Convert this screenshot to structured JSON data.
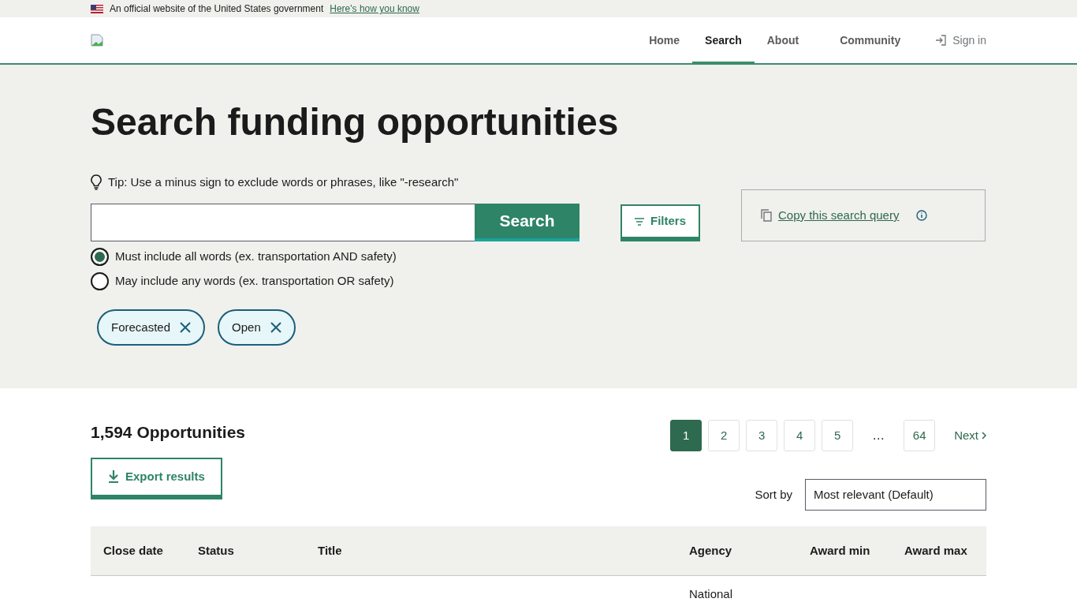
{
  "banner": {
    "text": "An official website of the United States government",
    "link": "Here's how you know"
  },
  "nav": {
    "items": [
      {
        "label": "Home",
        "selected": false
      },
      {
        "label": "Search",
        "selected": true
      },
      {
        "label": "About",
        "selected": false
      },
      {
        "label": "Community",
        "selected": false
      }
    ],
    "sign_in": "Sign in"
  },
  "title": "Search funding opportunities",
  "tip": "Tip: Use a minus sign to exclude words or phrases, like \"-research\"",
  "search": {
    "button": "Search"
  },
  "filters_button": "Filters",
  "copy_query": "Copy this search query",
  "match_options": [
    {
      "label": "Must include all words (ex. transportation AND safety)",
      "selected": true
    },
    {
      "label": "May include any words (ex. transportation OR safety)",
      "selected": false
    }
  ],
  "chips": [
    {
      "label": "Forecasted"
    },
    {
      "label": "Open"
    }
  ],
  "results_count": "1,594 Opportunities",
  "export_button": "Export results",
  "pagination": {
    "pages": [
      {
        "kind": "page",
        "label": "1",
        "selected": true
      },
      {
        "kind": "page",
        "label": "2",
        "selected": false
      },
      {
        "kind": "page",
        "label": "3",
        "selected": false
      },
      {
        "kind": "page",
        "label": "4",
        "selected": false
      },
      {
        "kind": "page",
        "label": "5",
        "selected": false
      },
      {
        "kind": "ellipsis",
        "label": "…"
      },
      {
        "kind": "page",
        "label": "64",
        "selected": false
      }
    ],
    "next": "Next"
  },
  "sort": {
    "label": "Sort by",
    "value": "Most relevant (Default)"
  },
  "table": {
    "columns": [
      "Close date",
      "Status",
      "Title",
      "Agency",
      "Award min",
      "Award max"
    ],
    "rows": [
      {
        "agency": "National"
      }
    ]
  }
}
